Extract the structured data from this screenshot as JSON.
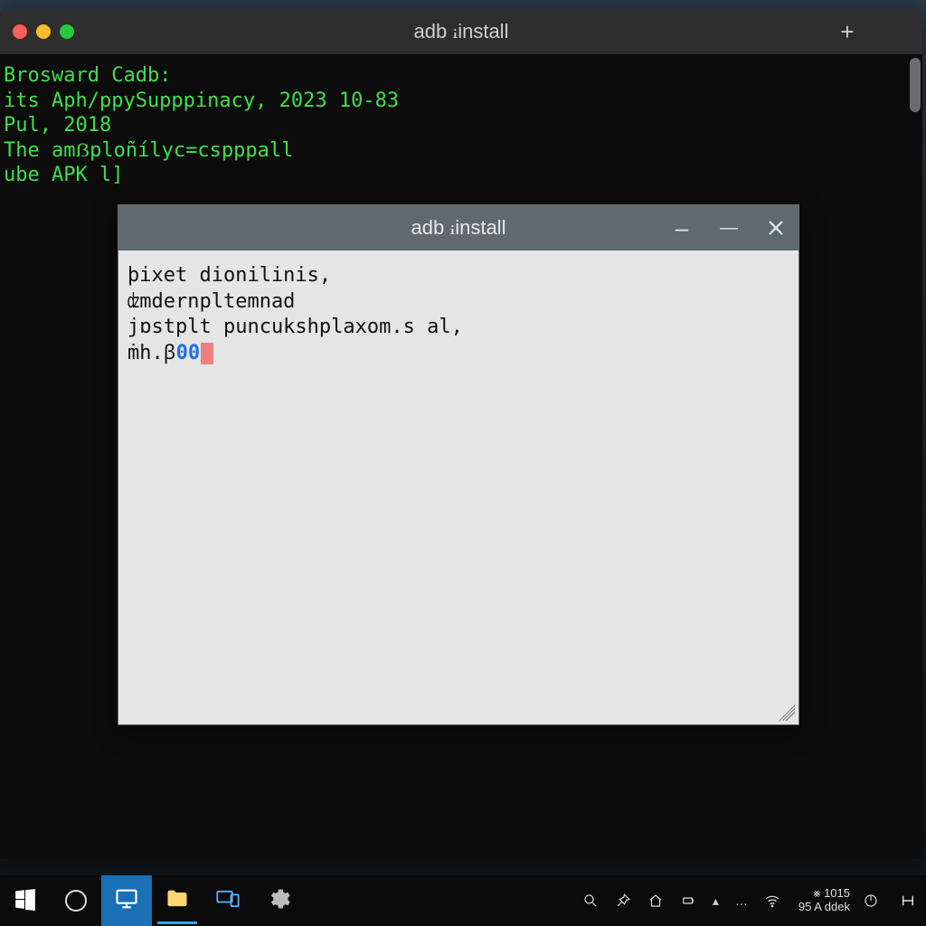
{
  "terminal": {
    "title": "adb ꭵinstall",
    "lines": [
      "Brosward Cadb:",
      "its Aph/ppySupppinacy, 2023 10-83",
      "Pul, 2018",
      "",
      "The amẞploñílyc=cspppall",
      "",
      "ube APK l]"
    ]
  },
  "dialog": {
    "title": "adb ꭵinstall",
    "lines": [
      "þixet dioոilinis,",
      "ʣmdernpltemnad",
      "jɒstplt puncukshplaxom.s al,",
      "ṁh.ꞵ00‾"
    ],
    "highlight_fragment": "00",
    "line3_prefix": "ṁh.ꞵ"
  },
  "taskbar": {
    "stat_top": "1015",
    "stat_bottom": "95",
    "time_top": "⨳ ",
    "time_bottom": "A ddek"
  }
}
